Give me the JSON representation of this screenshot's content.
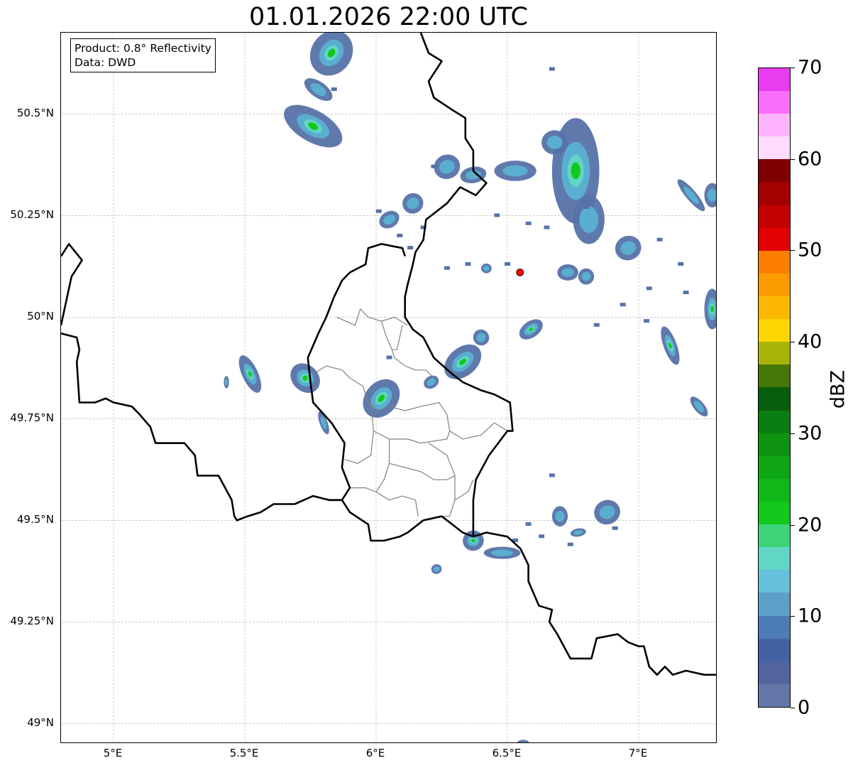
{
  "title": "01.01.2026 22:00 UTC",
  "info_box": {
    "product": "Product: 0.8° Reflectivity",
    "source": "Data: DWD"
  },
  "map_extent": {
    "lon_min": 4.8,
    "lon_max": 7.3,
    "lat_min": 48.95,
    "lat_max": 50.7
  },
  "lat_ticks": [
    {
      "value": 50.5,
      "label": "50.5°N"
    },
    {
      "value": 50.25,
      "label": "50.25°N"
    },
    {
      "value": 50.0,
      "label": "50°N"
    },
    {
      "value": 49.75,
      "label": "49.75°N"
    },
    {
      "value": 49.5,
      "label": "49.5°N"
    },
    {
      "value": 49.25,
      "label": "49.25°N"
    },
    {
      "value": 49.0,
      "label": "49°N"
    }
  ],
  "lon_ticks": [
    {
      "value": 5.0,
      "label": "5°E"
    },
    {
      "value": 5.5,
      "label": "5.5°E"
    },
    {
      "value": 6.0,
      "label": "6°E"
    },
    {
      "value": 6.5,
      "label": "6.5°E"
    },
    {
      "value": 7.0,
      "label": "7°E"
    }
  ],
  "radar_site": {
    "lon": 6.548,
    "lat": 50.11,
    "color": "#ff0000"
  },
  "colorbar": {
    "label": "dBZ",
    "min": 0,
    "max": 70,
    "ticks": [
      "0",
      "10",
      "20",
      "30",
      "40",
      "50",
      "60",
      "70"
    ],
    "colors": [
      "#6577a8",
      "#52649e",
      "#4462a3",
      "#4c7cb3",
      "#5ca0c8",
      "#66c0dc",
      "#62d6c4",
      "#3cd476",
      "#12c81a",
      "#10b818",
      "#0fa614",
      "#0d9212",
      "#0a7e10",
      "#065f0c",
      "#467808",
      "#aab408",
      "#fed500",
      "#fcb800",
      "#fc9c00",
      "#fd7e00",
      "#e40000",
      "#c40000",
      "#a40000",
      "#7f0000",
      "#ffdcfd",
      "#feb4fe",
      "#fb6efc",
      "#ea3cef"
    ]
  },
  "echo_palette": {
    "weak": "#5672a8",
    "medium": "#5ab4d4",
    "cyan": "#62d6c4",
    "green": "#12c81a"
  },
  "echo_cells": [
    {
      "lon": 5.83,
      "lat": 50.65,
      "dlon": 0.09,
      "dlat": 0.05,
      "rot": -55,
      "core": true
    },
    {
      "lon": 5.76,
      "lat": 50.47,
      "dlon": 0.06,
      "dlat": 0.08,
      "rot": -60,
      "core": true
    },
    {
      "lon": 5.78,
      "lat": 50.56,
      "dlon": 0.03,
      "dlat": 0.04,
      "rot": -55,
      "core": false
    },
    {
      "lon": 6.27,
      "lat": 50.37,
      "dlon": 0.05,
      "dlat": 0.03,
      "rot": -20,
      "core": false
    },
    {
      "lon": 6.37,
      "lat": 50.35,
      "dlon": 0.05,
      "dlat": 0.02,
      "rot": -10,
      "core": false
    },
    {
      "lon": 6.53,
      "lat": 50.36,
      "dlon": 0.08,
      "dlat": 0.025,
      "rot": 0,
      "core": false
    },
    {
      "lon": 6.76,
      "lat": 50.36,
      "dlon": 0.09,
      "dlat": 0.13,
      "rot": 0,
      "core": true
    },
    {
      "lon": 6.68,
      "lat": 50.43,
      "dlon": 0.05,
      "dlat": 0.03,
      "rot": 0,
      "core": false
    },
    {
      "lon": 6.81,
      "lat": 50.24,
      "dlon": 0.06,
      "dlat": 0.06,
      "rot": 0,
      "core": false
    },
    {
      "lon": 6.14,
      "lat": 50.28,
      "dlon": 0.04,
      "dlat": 0.025,
      "rot": -30,
      "core": false
    },
    {
      "lon": 6.05,
      "lat": 50.24,
      "dlon": 0.04,
      "dlat": 0.02,
      "rot": -30,
      "core": false
    },
    {
      "lon": 7.2,
      "lat": 50.3,
      "dlon": 0.02,
      "dlat": 0.05,
      "rot": -40,
      "core": false
    },
    {
      "lon": 7.28,
      "lat": 50.3,
      "dlon": 0.03,
      "dlat": 0.03,
      "rot": 0,
      "core": false
    },
    {
      "lon": 6.96,
      "lat": 50.17,
      "dlon": 0.05,
      "dlat": 0.03,
      "rot": -20,
      "core": false
    },
    {
      "lon": 6.73,
      "lat": 50.11,
      "dlon": 0.04,
      "dlat": 0.02,
      "rot": 0,
      "core": false
    },
    {
      "lon": 6.8,
      "lat": 50.1,
      "dlon": 0.03,
      "dlat": 0.02,
      "rot": 0,
      "core": false
    },
    {
      "lon": 6.42,
      "lat": 50.12,
      "dlon": 0.02,
      "dlat": 0.012,
      "rot": 0,
      "core": false
    },
    {
      "lon": 7.28,
      "lat": 50.02,
      "dlon": 0.03,
      "dlat": 0.05,
      "rot": 0,
      "core": true
    },
    {
      "lon": 7.12,
      "lat": 49.93,
      "dlon": 0.025,
      "dlat": 0.05,
      "rot": -20,
      "core": true
    },
    {
      "lon": 6.59,
      "lat": 49.97,
      "dlon": 0.05,
      "dlat": 0.02,
      "rot": -35,
      "core": true
    },
    {
      "lon": 6.4,
      "lat": 49.95,
      "dlon": 0.03,
      "dlat": 0.02,
      "rot": -45,
      "core": false
    },
    {
      "lon": 6.33,
      "lat": 49.89,
      "dlon": 0.08,
      "dlat": 0.035,
      "rot": -40,
      "core": true
    },
    {
      "lon": 6.21,
      "lat": 49.84,
      "dlon": 0.03,
      "dlat": 0.015,
      "rot": -30,
      "core": false
    },
    {
      "lon": 5.52,
      "lat": 49.86,
      "dlon": 0.03,
      "dlat": 0.05,
      "rot": -25,
      "core": true
    },
    {
      "lon": 5.43,
      "lat": 49.84,
      "dlon": 0.01,
      "dlat": 0.015,
      "rot": 0,
      "core": false
    },
    {
      "lon": 5.73,
      "lat": 49.85,
      "dlon": 0.05,
      "dlat": 0.04,
      "rot": -45,
      "core": true
    },
    {
      "lon": 5.8,
      "lat": 49.74,
      "dlon": 0.015,
      "dlat": 0.03,
      "rot": -20,
      "core": false
    },
    {
      "lon": 6.02,
      "lat": 49.8,
      "dlon": 0.08,
      "dlat": 0.04,
      "rot": -50,
      "core": true
    },
    {
      "lon": 7.23,
      "lat": 49.78,
      "dlon": 0.02,
      "dlat": 0.03,
      "rot": -40,
      "core": false
    },
    {
      "lon": 6.88,
      "lat": 49.52,
      "dlon": 0.05,
      "dlat": 0.03,
      "rot": -20,
      "core": false
    },
    {
      "lon": 6.7,
      "lat": 49.51,
      "dlon": 0.03,
      "dlat": 0.025,
      "rot": 0,
      "core": false
    },
    {
      "lon": 6.77,
      "lat": 49.47,
      "dlon": 0.03,
      "dlat": 0.01,
      "rot": -10,
      "core": false
    },
    {
      "lon": 6.37,
      "lat": 49.45,
      "dlon": 0.04,
      "dlat": 0.025,
      "rot": -10,
      "core": true
    },
    {
      "lon": 6.48,
      "lat": 49.42,
      "dlon": 0.07,
      "dlat": 0.015,
      "rot": 0,
      "core": false
    },
    {
      "lon": 6.23,
      "lat": 49.38,
      "dlon": 0.02,
      "dlat": 0.012,
      "rot": -15,
      "core": false
    },
    {
      "lon": 6.56,
      "lat": 48.95,
      "dlon": 0.025,
      "dlat": 0.01,
      "rot": 0,
      "core": false
    }
  ],
  "scatter_echoes": [
    [
      6.67,
      50.61
    ],
    [
      6.58,
      50.23
    ],
    [
      6.65,
      50.22
    ],
    [
      6.8,
      50.27
    ],
    [
      6.5,
      50.13
    ],
    [
      6.35,
      50.13
    ],
    [
      6.27,
      50.12
    ],
    [
      6.94,
      50.03
    ],
    [
      7.04,
      50.07
    ],
    [
      6.84,
      49.98
    ],
    [
      7.16,
      50.13
    ],
    [
      7.18,
      50.06
    ],
    [
      6.67,
      49.61
    ],
    [
      6.58,
      49.49
    ],
    [
      6.63,
      49.46
    ],
    [
      6.91,
      49.48
    ],
    [
      6.53,
      49.45
    ],
    [
      6.05,
      49.9
    ],
    [
      6.09,
      50.2
    ],
    [
      6.18,
      50.22
    ],
    [
      6.01,
      50.26
    ],
    [
      7.03,
      49.99
    ],
    [
      6.74,
      49.44
    ],
    [
      6.22,
      50.37
    ],
    [
      6.13,
      50.17
    ],
    [
      6.46,
      50.25
    ],
    [
      7.08,
      50.19
    ],
    [
      5.84,
      50.56
    ]
  ],
  "borders_country": [
    [
      [
        4.8,
        50.15
      ],
      [
        4.83,
        50.18
      ],
      [
        4.88,
        50.14
      ],
      [
        4.84,
        50.1
      ],
      [
        4.82,
        50.04
      ],
      [
        4.8,
        49.98
      ]
    ],
    [
      [
        4.8,
        49.96
      ],
      [
        4.86,
        49.95
      ],
      [
        4.87,
        49.92
      ],
      [
        4.86,
        49.89
      ],
      [
        4.87,
        49.79
      ],
      [
        4.93,
        49.79
      ],
      [
        4.97,
        49.8
      ],
      [
        5.0,
        49.79
      ],
      [
        5.07,
        49.78
      ],
      [
        5.1,
        49.76
      ],
      [
        5.14,
        49.73
      ],
      [
        5.16,
        49.69
      ],
      [
        5.27,
        49.69
      ],
      [
        5.31,
        49.66
      ],
      [
        5.32,
        49.61
      ],
      [
        5.4,
        49.61
      ],
      [
        5.45,
        49.55
      ],
      [
        5.46,
        49.51
      ],
      [
        5.47,
        49.5
      ],
      [
        5.51,
        49.51
      ],
      [
        5.56,
        49.52
      ],
      [
        5.61,
        49.54
      ],
      [
        5.69,
        49.54
      ],
      [
        5.76,
        49.56
      ],
      [
        5.82,
        49.55
      ],
      [
        5.87,
        49.55
      ],
      [
        5.9,
        49.52
      ],
      [
        5.97,
        49.49
      ],
      [
        5.98,
        49.45
      ],
      [
        6.03,
        49.45
      ],
      [
        6.09,
        49.46
      ],
      [
        6.12,
        49.47
      ],
      [
        6.18,
        49.5
      ],
      [
        6.25,
        49.51
      ],
      [
        6.33,
        49.47
      ],
      [
        6.37,
        49.46
      ],
      [
        6.42,
        49.47
      ],
      [
        6.5,
        49.46
      ],
      [
        6.55,
        49.43
      ],
      [
        6.58,
        49.39
      ],
      [
        6.58,
        49.35
      ],
      [
        6.62,
        49.29
      ],
      [
        6.67,
        49.28
      ],
      [
        6.66,
        49.25
      ],
      [
        6.69,
        49.22
      ],
      [
        6.74,
        49.16
      ],
      [
        6.82,
        49.16
      ],
      [
        6.84,
        49.21
      ],
      [
        6.92,
        49.22
      ],
      [
        6.96,
        49.2
      ],
      [
        7.0,
        49.19
      ],
      [
        7.02,
        49.19
      ],
      [
        7.04,
        49.14
      ],
      [
        7.07,
        49.12
      ],
      [
        7.1,
        49.14
      ],
      [
        7.13,
        49.12
      ],
      [
        7.18,
        49.13
      ],
      [
        7.25,
        49.12
      ],
      [
        7.3,
        49.12
      ]
    ],
    [
      [
        6.17,
        50.7
      ],
      [
        6.2,
        50.65
      ],
      [
        6.25,
        50.63
      ],
      [
        6.2,
        50.58
      ],
      [
        6.22,
        50.54
      ],
      [
        6.29,
        50.51
      ],
      [
        6.34,
        50.49
      ],
      [
        6.34,
        50.44
      ],
      [
        6.37,
        50.41
      ],
      [
        6.37,
        50.36
      ],
      [
        6.42,
        50.33
      ],
      [
        6.38,
        50.3
      ],
      [
        6.32,
        50.32
      ],
      [
        6.27,
        50.28
      ],
      [
        6.19,
        50.24
      ],
      [
        6.18,
        50.19
      ],
      [
        6.15,
        50.16
      ],
      [
        6.14,
        50.13
      ],
      [
        6.12,
        50.08
      ],
      [
        6.11,
        50.05
      ],
      [
        6.11,
        50.0
      ],
      [
        6.14,
        49.97
      ],
      [
        6.18,
        49.95
      ],
      [
        6.22,
        49.9
      ],
      [
        6.29,
        49.86
      ],
      [
        6.33,
        49.84
      ],
      [
        6.4,
        49.82
      ],
      [
        6.45,
        49.81
      ],
      [
        6.51,
        49.79
      ],
      [
        6.52,
        49.72
      ],
      [
        6.5,
        49.72
      ],
      [
        6.43,
        49.66
      ],
      [
        6.38,
        49.6
      ],
      [
        6.37,
        49.55
      ],
      [
        6.37,
        49.46
      ]
    ],
    [
      [
        6.11,
        50.15
      ],
      [
        6.1,
        50.17
      ],
      [
        6.02,
        50.18
      ],
      [
        5.97,
        50.17
      ],
      [
        5.96,
        50.13
      ],
      [
        5.9,
        50.11
      ],
      [
        5.87,
        50.09
      ],
      [
        5.84,
        50.05
      ],
      [
        5.81,
        50.0
      ],
      [
        5.78,
        49.96
      ],
      [
        5.74,
        49.9
      ],
      [
        5.75,
        49.84
      ],
      [
        5.76,
        49.79
      ],
      [
        5.83,
        49.74
      ],
      [
        5.88,
        49.69
      ],
      [
        5.87,
        49.63
      ],
      [
        5.9,
        49.58
      ],
      [
        5.87,
        49.55
      ],
      [
        5.82,
        49.55
      ]
    ]
  ],
  "borders_admin": [
    [
      [
        5.85,
        50.0
      ],
      [
        5.92,
        49.98
      ],
      [
        5.94,
        50.02
      ],
      [
        5.97,
        50.0
      ],
      [
        6.02,
        49.99
      ],
      [
        6.07,
        50.0
      ],
      [
        6.12,
        49.98
      ]
    ],
    [
      [
        6.02,
        49.99
      ],
      [
        6.04,
        49.95
      ],
      [
        6.06,
        49.92
      ],
      [
        6.07,
        49.9
      ],
      [
        6.11,
        49.88
      ],
      [
        6.15,
        49.87
      ],
      [
        6.19,
        49.87
      ],
      [
        6.22,
        49.85
      ]
    ],
    [
      [
        6.1,
        49.98
      ],
      [
        6.08,
        49.92
      ],
      [
        6.06,
        49.92
      ]
    ],
    [
      [
        5.76,
        49.86
      ],
      [
        5.81,
        49.88
      ],
      [
        5.87,
        49.87
      ],
      [
        5.9,
        49.85
      ],
      [
        5.95,
        49.83
      ],
      [
        5.97,
        49.79
      ],
      [
        6.01,
        49.77
      ],
      [
        6.05,
        49.78
      ],
      [
        6.11,
        49.77
      ],
      [
        6.17,
        49.78
      ],
      [
        6.24,
        49.79
      ],
      [
        6.27,
        49.76
      ],
      [
        6.28,
        49.72
      ],
      [
        6.33,
        49.7
      ],
      [
        6.4,
        49.71
      ],
      [
        6.45,
        49.74
      ],
      [
        6.5,
        49.72
      ]
    ],
    [
      [
        5.98,
        49.79
      ],
      [
        5.99,
        49.72
      ],
      [
        5.98,
        49.66
      ],
      [
        5.93,
        49.64
      ],
      [
        5.88,
        49.65
      ]
    ],
    [
      [
        5.99,
        49.72
      ],
      [
        6.05,
        49.7
      ],
      [
        6.12,
        49.7
      ],
      [
        6.17,
        49.69
      ],
      [
        6.27,
        49.7
      ],
      [
        6.28,
        49.72
      ]
    ],
    [
      [
        6.05,
        49.7
      ],
      [
        6.05,
        49.64
      ],
      [
        6.03,
        49.6
      ],
      [
        6.0,
        49.57
      ],
      [
        5.96,
        49.58
      ],
      [
        5.9,
        49.58
      ]
    ],
    [
      [
        6.2,
        49.69
      ],
      [
        6.27,
        49.66
      ],
      [
        6.3,
        49.61
      ],
      [
        6.3,
        49.55
      ],
      [
        6.28,
        49.51
      ],
      [
        6.25,
        49.51
      ]
    ],
    [
      [
        6.05,
        49.64
      ],
      [
        6.11,
        49.63
      ],
      [
        6.17,
        49.62
      ],
      [
        6.22,
        49.6
      ],
      [
        6.27,
        49.6
      ],
      [
        6.3,
        49.61
      ]
    ],
    [
      [
        6.3,
        49.55
      ],
      [
        6.35,
        49.57
      ],
      [
        6.37,
        49.6
      ]
    ],
    [
      [
        6.0,
        49.57
      ],
      [
        6.05,
        49.55
      ],
      [
        6.1,
        49.56
      ],
      [
        6.15,
        49.55
      ],
      [
        6.16,
        49.51
      ]
    ]
  ]
}
